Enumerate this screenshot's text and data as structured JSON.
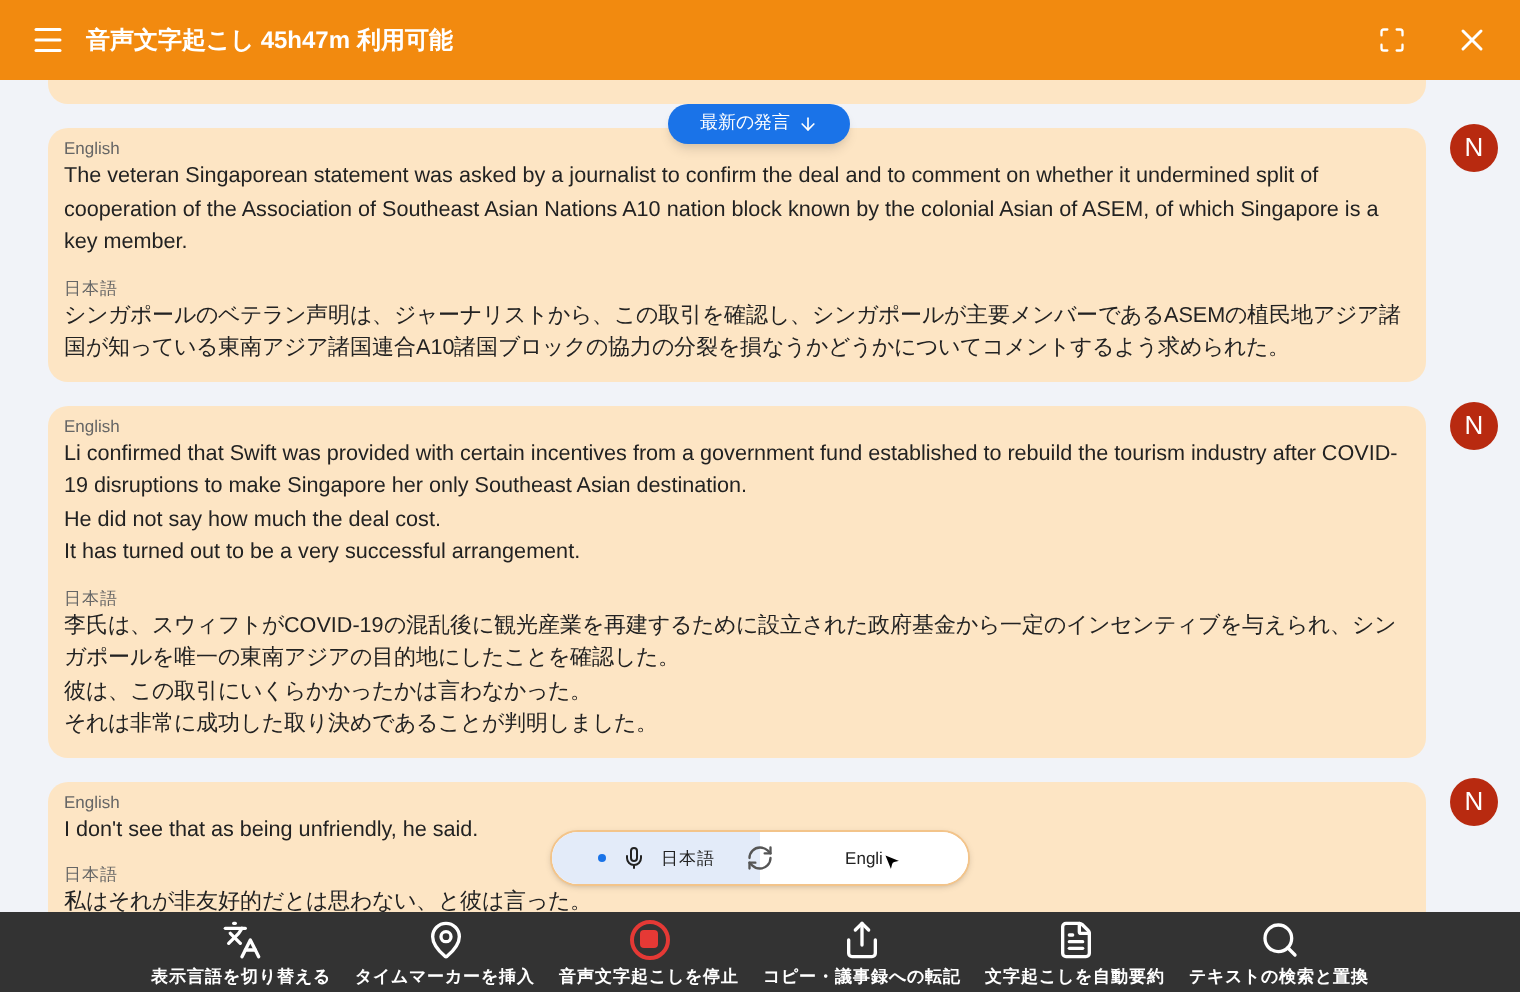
{
  "header": {
    "title": "音声文字起こし 45h47m 利用可能"
  },
  "latest_button": {
    "label": "最新の発言"
  },
  "utterances": [
    {
      "avatar": "N",
      "blocks": [
        {
          "language": "English",
          "lines": [
            "The veteran Singaporean statement was asked by a journalist to confirm the deal and to comment on whether it undermined split of cooperation of the Association of Southeast Asian Nations A10 nation block known by the colonial Asian of ASEM, of which Singapore is a key member."
          ]
        },
        {
          "language": "日本語",
          "lines": [
            "シンガポールのベテラン声明は、ジャーナリストから、この取引を確認し、シンガポールが主要メンバーであるASEMの植民地アジア諸国が知っている東南アジア諸国連合A10諸国ブロックの協力の分裂を損なうかどうかについてコメントするよう求められた。"
          ]
        }
      ]
    },
    {
      "avatar": "N",
      "blocks": [
        {
          "language": "English",
          "lines": [
            "Li confirmed that Swift was provided with certain incentives from a government fund established to rebuild the tourism industry after COVID-19 disruptions to make Singapore her only Southeast Asian destination.",
            "He did not say how much the deal cost.",
            "It has turned out to be a very successful arrangement."
          ]
        },
        {
          "language": "日本語",
          "lines": [
            "李氏は、スウィフトがCOVID-19の混乱後に観光産業を再建するために設立された政府基金から一定のインセンティブを与えられ、シンガポールを唯一の東南アジアの目的地にしたことを確認した。",
            "彼は、この取引にいくらかかったかは言わなかった。",
            "それは非常に成功した取り決めであることが判明しました。"
          ]
        }
      ]
    },
    {
      "avatar": "N",
      "blocks": [
        {
          "language": "English",
          "lines": [
            "I don't see that as being unfriendly, he said."
          ]
        },
        {
          "language": "日本語",
          "lines": [
            "私はそれが非友好的だとは思わない、と彼は言った。"
          ]
        }
      ]
    }
  ],
  "language_toggle": [
    {
      "label": "日本語",
      "selected": true
    },
    {
      "label": "Engli",
      "selected": false
    }
  ],
  "toolbar": [
    {
      "kind": "language",
      "label": "表示言語を切り替える"
    },
    {
      "kind": "marker",
      "label": "タイムマーカーを挿入"
    },
    {
      "kind": "stop",
      "label": "音声文字起こしを停止"
    },
    {
      "kind": "share",
      "label": "コピー・議事録への転記"
    },
    {
      "kind": "summary",
      "label": "文字起こしを自動要約"
    },
    {
      "kind": "search",
      "label": "テキストの検索と置換"
    }
  ]
}
